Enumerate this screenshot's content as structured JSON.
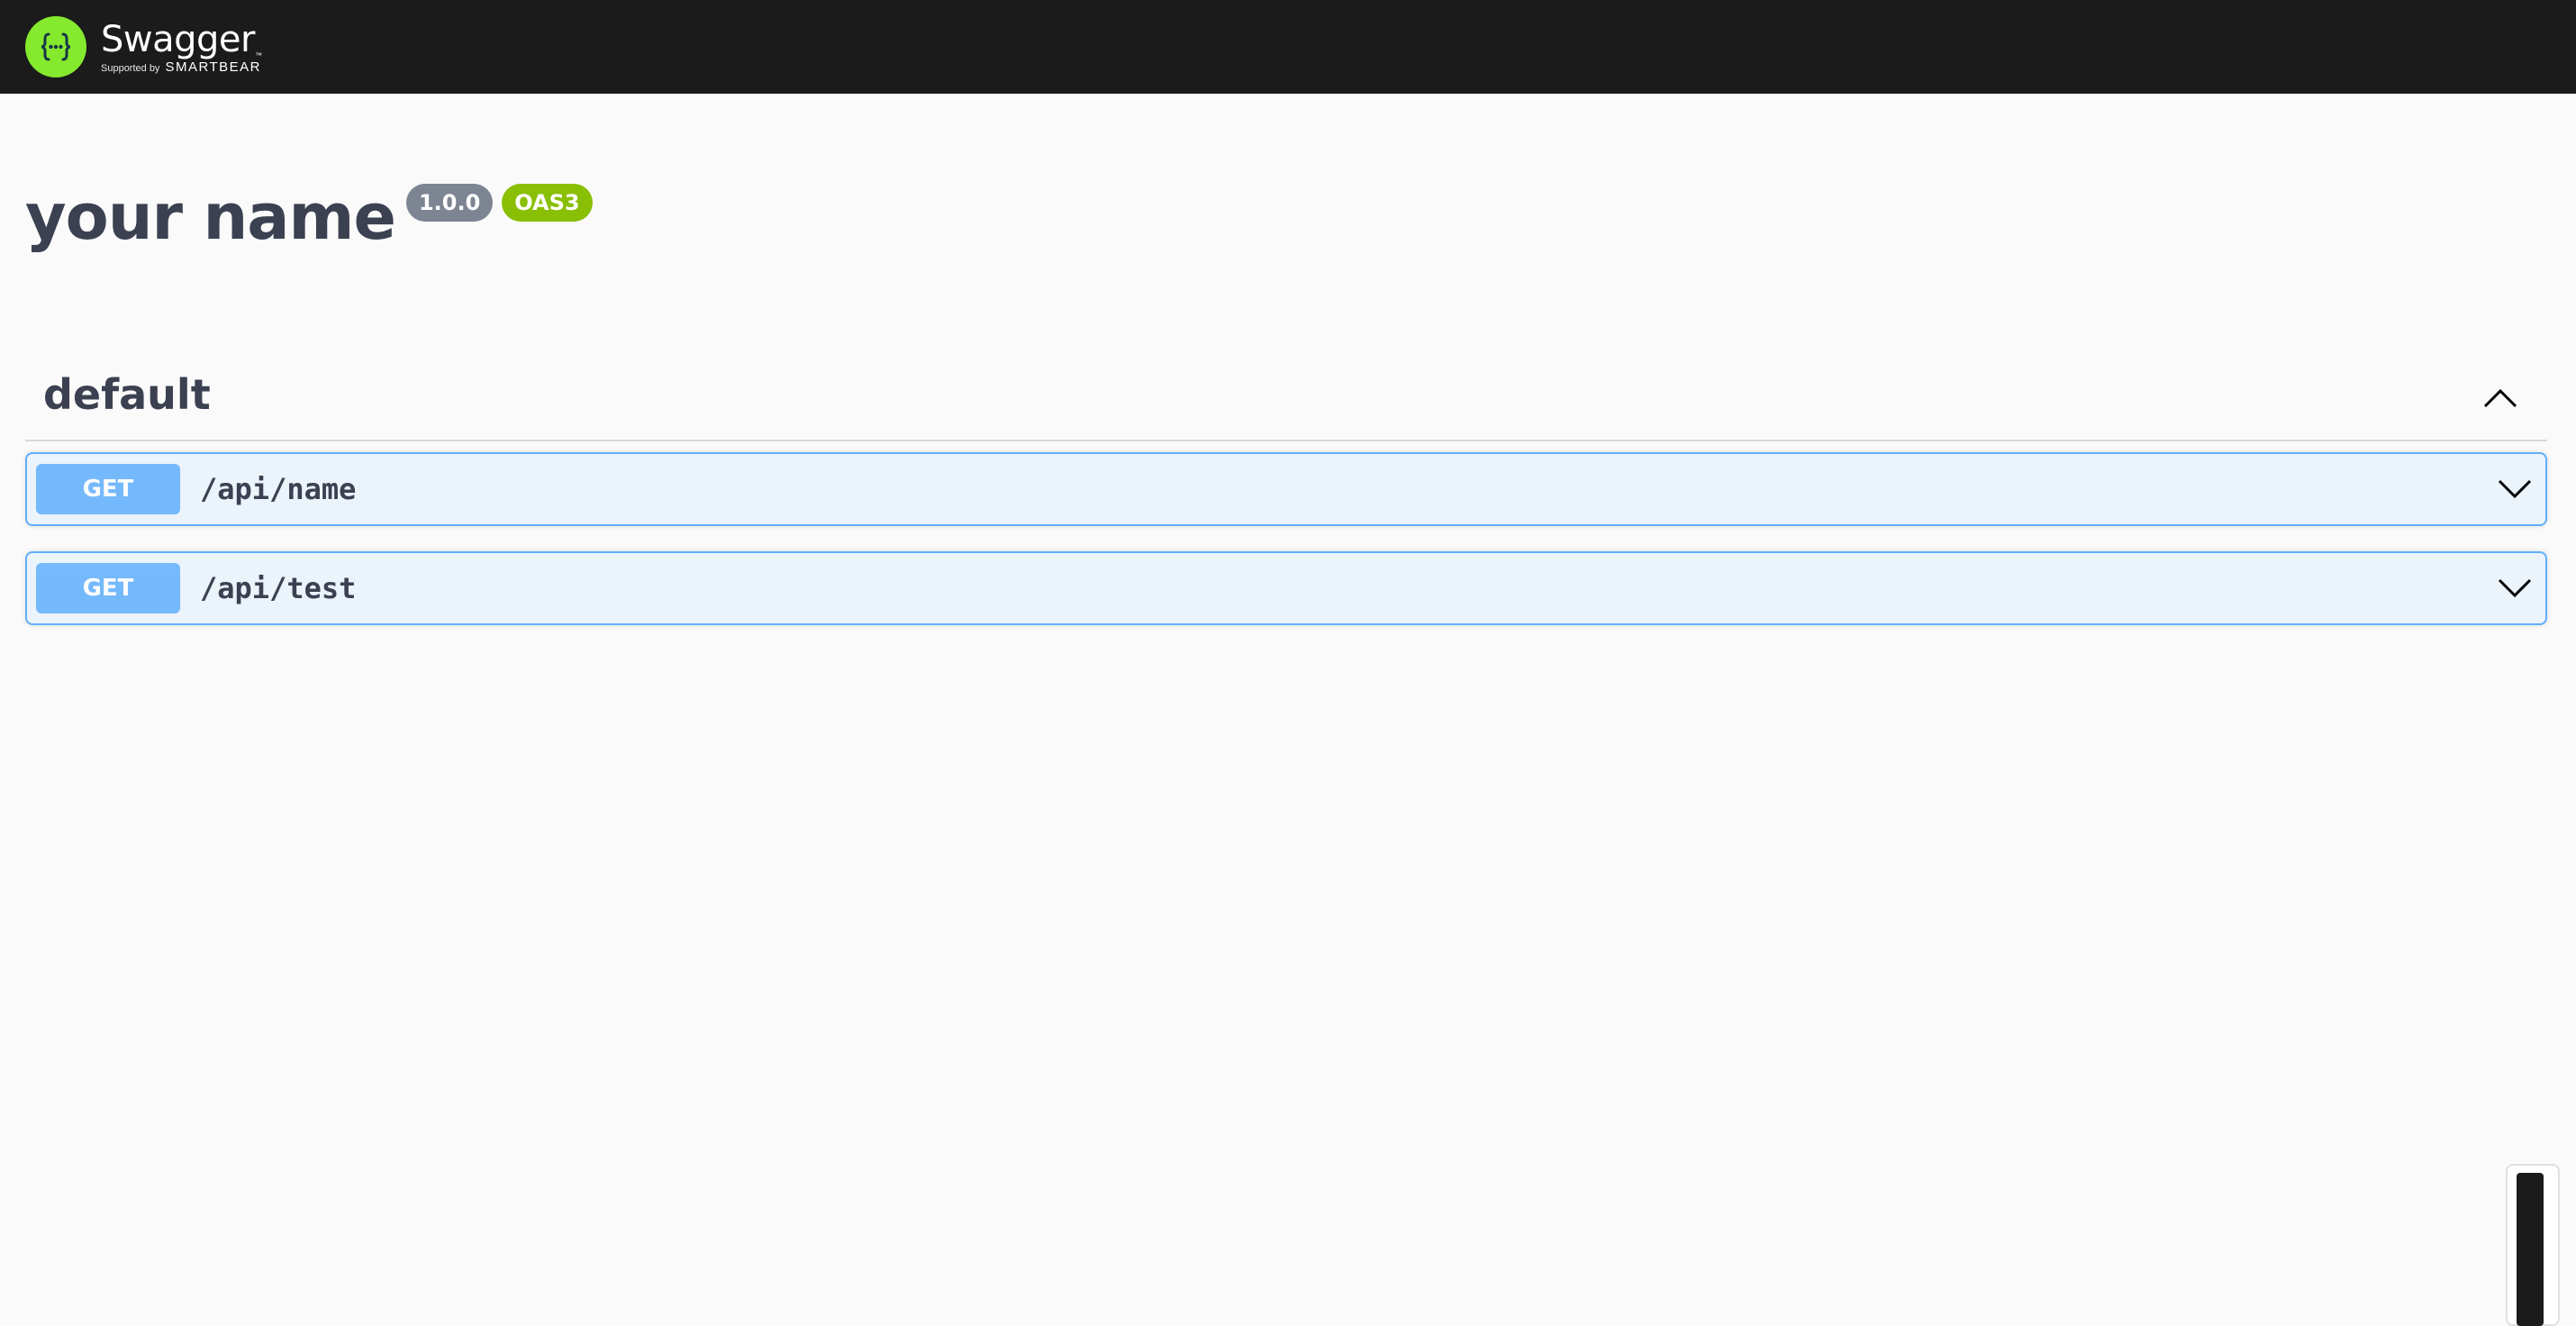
{
  "header": {
    "brand_name": "Swagger",
    "brand_tm": "™",
    "supported_by": "Supported by",
    "smartbear": "SMARTBEAR",
    "logo_icon": "swagger-logo-icon",
    "logo_color": "#85ea2d"
  },
  "info": {
    "title": "your name",
    "version": "1.0.0",
    "spec": "OAS3"
  },
  "tag": {
    "name": "default",
    "expanded": true
  },
  "operations": [
    {
      "method": "GET",
      "path": "/api/name",
      "expanded": false
    },
    {
      "method": "GET",
      "path": "/api/test",
      "expanded": false
    }
  ],
  "colors": {
    "get_method": "#61affe",
    "get_background": "#ebf3fb",
    "topbar": "#1b1b1b",
    "title_text": "#3b4151",
    "version_badge": "#7d8492",
    "oas_badge": "#89bf04"
  }
}
